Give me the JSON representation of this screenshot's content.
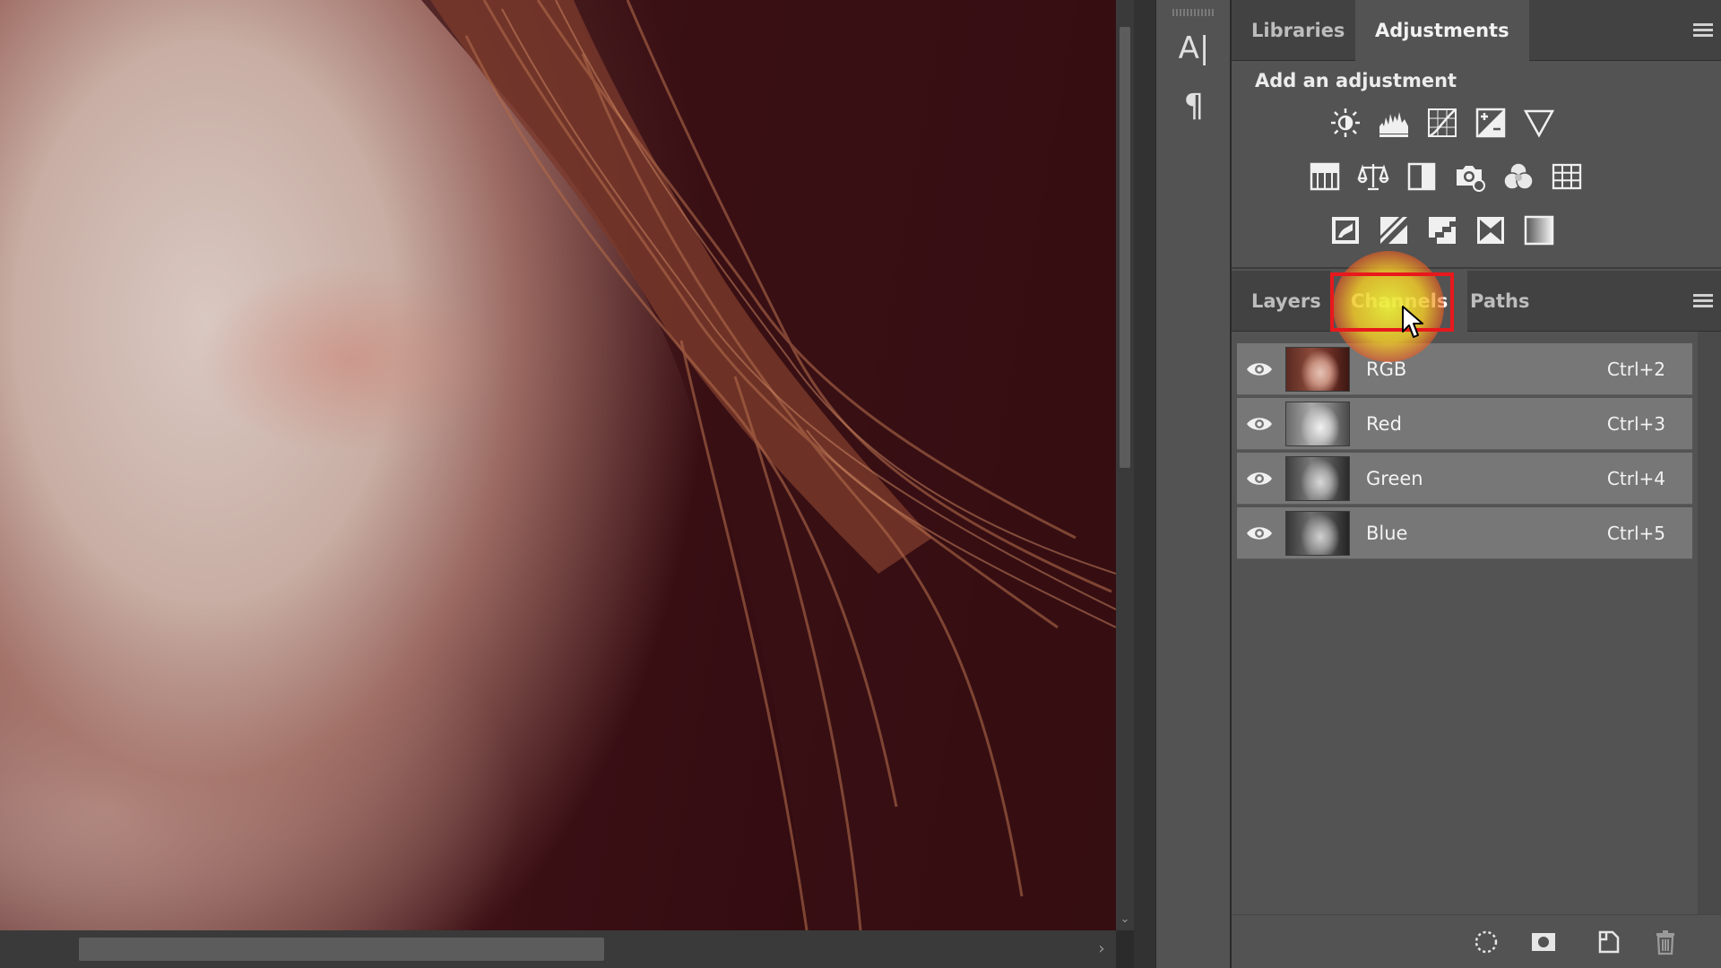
{
  "adjustments_panel": {
    "tabs": [
      {
        "label": "Libraries",
        "active": false
      },
      {
        "label": "Adjustments",
        "active": true
      }
    ],
    "title": "Add an adjustment",
    "icon_rows": [
      [
        "brightness-contrast-icon",
        "levels-icon",
        "curves-icon",
        "exposure-icon",
        "vibrance-icon"
      ],
      [
        "hue-saturation-icon",
        "color-balance-icon",
        "black-white-icon",
        "photo-filter-icon",
        "channel-mixer-icon",
        "color-lookup-icon"
      ],
      [
        "invert-icon",
        "posterize-icon",
        "threshold-icon",
        "selective-color-icon",
        "gradient-map-icon"
      ]
    ]
  },
  "channels_panel": {
    "tabs": [
      {
        "label": "Layers",
        "active": false
      },
      {
        "label": "Channels",
        "active": true
      },
      {
        "label": "Paths",
        "active": false
      }
    ],
    "channels": [
      {
        "name": "RGB",
        "shortcut": "Ctrl+2",
        "visible": true
      },
      {
        "name": "Red",
        "shortcut": "Ctrl+3",
        "visible": true
      },
      {
        "name": "Green",
        "shortcut": "Ctrl+4",
        "visible": true
      },
      {
        "name": "Blue",
        "shortcut": "Ctrl+5",
        "visible": true
      }
    ],
    "footer_buttons": [
      "load-selection-icon",
      "save-selection-icon",
      "new-channel-icon",
      "trash-icon"
    ]
  },
  "toolstrip": {
    "icons": [
      "character-icon",
      "paragraph-icon"
    ],
    "character_glyph": "A|",
    "paragraph_glyph": "¶"
  },
  "colors": {
    "panel_bg": "#535353",
    "tab_bar_bg": "#424242",
    "row_bg": "#777777",
    "highlight_box": "#e8181c",
    "highlight_glow": "#ebf03c"
  }
}
